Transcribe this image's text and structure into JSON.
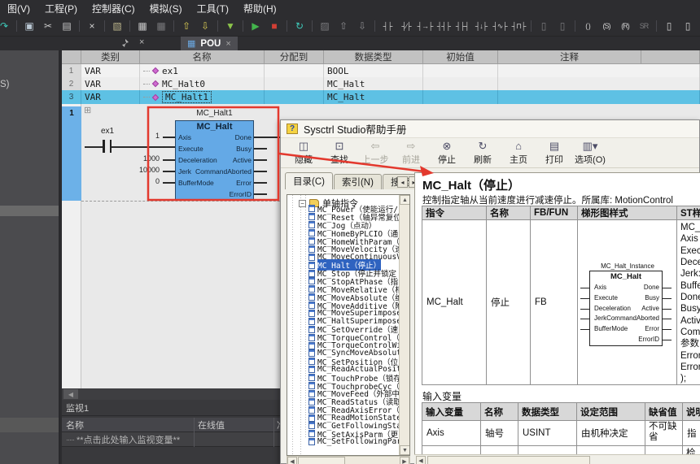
{
  "colors": {
    "accent_blue": "#64a9e6",
    "selection_cyan": "#5ec1e4",
    "annotation_red": "#e3392e",
    "tree_select": "#2f63c0",
    "dark_ui": "#2d2d30",
    "help_bg": "#f1f0ea"
  },
  "menu": {
    "items": [
      {
        "label": "图(V)",
        "name": "view"
      },
      {
        "label": "工程(P)",
        "name": "project"
      },
      {
        "label": "控制器(C)",
        "name": "controller"
      },
      {
        "label": "模拟(S)",
        "name": "simulate"
      },
      {
        "label": "工具(T)",
        "name": "tools"
      },
      {
        "label": "帮助(H)",
        "name": "help"
      }
    ]
  },
  "toolbar": {
    "icons": [
      {
        "glyph": "↷",
        "color": "#3ec9b9",
        "cls": "clip",
        "name": "redo"
      },
      {
        "glyph": "",
        "cls": "sep"
      },
      {
        "glyph": "▣",
        "color": "#b9c6d2",
        "name": "copy"
      },
      {
        "glyph": "✂",
        "color": "#c8c8c8",
        "name": "cut"
      },
      {
        "glyph": "▤",
        "color": "#c8c8c8",
        "name": "paste"
      },
      {
        "glyph": "",
        "cls": "sep"
      },
      {
        "glyph": "×",
        "color": "#d0d0d0",
        "name": "delete"
      },
      {
        "glyph": "",
        "cls": "sep"
      },
      {
        "glyph": "▧",
        "color": "#b9b28a",
        "name": "edit-doc"
      },
      {
        "glyph": "",
        "cls": "sep"
      },
      {
        "glyph": "▦",
        "color": "#c8c8c8",
        "name": "build"
      },
      {
        "glyph": "▦",
        "color": "#79797c",
        "name": "rebuild"
      },
      {
        "glyph": "",
        "cls": "sep"
      },
      {
        "glyph": "⇧",
        "color": "#d9cb54",
        "name": "download-plc"
      },
      {
        "glyph": "⇩",
        "color": "#d9cb54",
        "name": "upload-plc"
      },
      {
        "glyph": "",
        "cls": "sep"
      },
      {
        "glyph": "▼",
        "color": "#8bc34a",
        "name": "filter"
      },
      {
        "glyph": "",
        "cls": "sep"
      },
      {
        "glyph": "▶",
        "color": "#43b44c",
        "name": "run"
      },
      {
        "glyph": "■",
        "color": "#d23f35",
        "name": "stop"
      },
      {
        "glyph": "",
        "cls": "sep"
      },
      {
        "glyph": "↻",
        "color": "#3ec9b9",
        "name": "online-compare"
      },
      {
        "glyph": "",
        "cls": "sep"
      },
      {
        "glyph": "▨",
        "color": "#79797c",
        "name": "snippet"
      },
      {
        "glyph": "⇧",
        "color": "#8a8a8d",
        "name": "move-up"
      },
      {
        "glyph": "⇩",
        "color": "#8a8a8d",
        "name": "move-down"
      },
      {
        "glyph": "",
        "cls": "sep"
      },
      {
        "glyph": "┤├",
        "color": "#cfcfcf",
        "cls": "sm",
        "name": "contact-no"
      },
      {
        "glyph": "┤∕├",
        "color": "#cfcfcf",
        "cls": "sm",
        "name": "contact-nc"
      },
      {
        "glyph": "┤→├",
        "color": "#cfcfcf",
        "cls": "sm",
        "name": "contact-rising"
      },
      {
        "glyph": "┤┤├",
        "color": "#cfcfcf",
        "cls": "sm",
        "name": "contact-parallel-no"
      },
      {
        "glyph": "┤├┤",
        "color": "#cfcfcf",
        "cls": "sm",
        "name": "contact-parallel-nc"
      },
      {
        "glyph": "┤↓├",
        "color": "#cfcfcf",
        "cls": "sm",
        "name": "contact-falling"
      },
      {
        "glyph": "┤∿├",
        "color": "#cfcfcf",
        "cls": "sm",
        "name": "contact-pulse"
      },
      {
        "glyph": "┤⊓├",
        "color": "#cfcfcf",
        "cls": "sm",
        "name": "contact-edge"
      },
      {
        "glyph": "",
        "cls": "sep"
      },
      {
        "glyph": "▯",
        "color": "#79797c",
        "name": "box-dim-1"
      },
      {
        "glyph": "▯",
        "color": "#79797c",
        "name": "box-dim-2"
      },
      {
        "glyph": "",
        "cls": "sep"
      },
      {
        "glyph": "( )",
        "color": "#cfcfcf",
        "cls": "sm",
        "name": "coil"
      },
      {
        "glyph": "(S)",
        "color": "#cfcfcf",
        "cls": "sm",
        "name": "coil-set"
      },
      {
        "glyph": "(R)",
        "color": "#cfcfcf",
        "cls": "sm",
        "name": "coil-reset"
      },
      {
        "glyph": "SR",
        "color": "#79797c",
        "cls": "sm",
        "name": "sr-block"
      },
      {
        "glyph": "",
        "cls": "sep"
      },
      {
        "glyph": "▯",
        "color": "#cfcfcf",
        "name": "fb-insert"
      },
      {
        "glyph": "▯",
        "color": "#cfcfcf",
        "name": "fb-insert-2"
      }
    ]
  },
  "tabs": {
    "pou": "POU",
    "close": "×"
  },
  "sidebar": {
    "clipped_label": "S)"
  },
  "var_table": {
    "headers": [
      "类别",
      "名称",
      "分配到",
      "数据类型",
      "初始值",
      "注释"
    ],
    "rows": [
      {
        "num": "1",
        "cls": "VAR",
        "name": "ex1",
        "assigned": "",
        "type": "BOOL",
        "init": "",
        "comment": ""
      },
      {
        "num": "2",
        "cls": "VAR",
        "name": "MC_Halt0",
        "assigned": "",
        "type": "MC_Halt",
        "init": "",
        "comment": ""
      },
      {
        "num": "3",
        "cls": "VAR",
        "name": "MC_Halt1",
        "assigned": "",
        "type": "MC_Halt",
        "init": "",
        "comment": ""
      }
    ]
  },
  "ladder": {
    "rung_number": "1",
    "contact_label": "ex1",
    "instance_label": "MC_Halt1",
    "block_title": "MC_Halt",
    "inputs": [
      {
        "value": "1",
        "pin": "Axis"
      },
      {
        "value": "",
        "pin": "Execute"
      },
      {
        "value": "1000",
        "pin": "Deceleration"
      },
      {
        "value": "10000",
        "pin": "Jerk"
      },
      {
        "value": "0",
        "pin": "BufferMode"
      }
    ],
    "outputs": [
      "Done",
      "Busy",
      "Active",
      "CommandAborted",
      "Error",
      "ErrorID"
    ]
  },
  "watch": {
    "title": "监视1",
    "col_name": "名称",
    "col_online": "在线值",
    "col_prepared": "准备值",
    "placeholder": "**点击此处输入监视变量**"
  },
  "help": {
    "title": "Sysctrl Studio帮助手册",
    "book_glyph": "?",
    "buttons": [
      {
        "label": "隐藏",
        "glyph": "◫",
        "name": "hide"
      },
      {
        "label": "查找",
        "glyph": "⊡",
        "name": "find"
      },
      {
        "label": "上一步",
        "glyph": "⇦",
        "cls": "disabled",
        "name": "back"
      },
      {
        "label": "前进",
        "glyph": "⇨",
        "cls": "disabled",
        "name": "forward"
      },
      {
        "label": "停止",
        "glyph": "⊗",
        "name": "stop"
      },
      {
        "label": "刷新",
        "glyph": "↻",
        "name": "refresh"
      },
      {
        "label": "主页",
        "glyph": "⌂",
        "name": "home"
      },
      {
        "label": "打印",
        "glyph": "▤",
        "name": "print"
      },
      {
        "label": "选项(O)",
        "glyph": "▥▾",
        "name": "options"
      }
    ],
    "tabs": [
      {
        "label": "目录(C)",
        "cls": "active",
        "name": "contents"
      },
      {
        "label": "索引(N)",
        "name": "index"
      },
      {
        "label": "搜索(S)",
        "name": "search"
      }
    ],
    "tree": {
      "root": "单轴指令",
      "selected_index": 7,
      "items": [
        "MC_Power（使能运行/",
        "MC_Reset（轴异常复位",
        "MC_Jog（点动）",
        "MC_HomeByPLCIO（通",
        "MC_HomeWithParam（参",
        "MC_MoveVelocity（速",
        "MC_MoveContinuousV",
        "MC_Halt（停止）",
        "MC_Stop（停止并锁定",
        "MC_StopAtPhase（指",
        "MC_MoveRelative（相",
        "MC_MoveAbsolute（绝",
        "MC_MoveAdditive（附",
        "MC_MoveSuperimpose",
        "MC_HaltSuperimpose",
        "MC_SetOverride（速",
        "MC_TorqueControl（",
        "MC_TorqueControlWi",
        "MC_SyncMoveAbsolut",
        "MC_SetPosition（位",
        "MC_ReadActualPosit",
        "MC_TouchProbe（锁存",
        "MC_TouchprobeCyc（",
        "MC_MoveFeed（外部中",
        "MC_ReadStatus（读取",
        "MC_ReadAxisError（",
        "MC_ReadMotionState",
        "MC_GetFollowingSta",
        "MC_SetAxisParm（更",
        "MC_SetFollowingPar"
      ]
    },
    "content": {
      "title": "MC_Halt（停止）",
      "desc": "控制指定轴从当前速度进行减速停止。所属库: MotionControl",
      "t1_headers": [
        "指令",
        "名称",
        "FB/FUN",
        "梯形图样式",
        "ST样式"
      ],
      "t1_row": {
        "cmd": "MC_Halt",
        "name": "停止",
        "fbfun": "FB"
      },
      "diagram": {
        "instance": "MC_Halt_Instance",
        "title": "MC_Halt",
        "inputs": [
          "Axis",
          "Execute",
          "Deceleration",
          "Jerk",
          "BufferMode"
        ],
        "outputs": [
          "Done",
          "Busy",
          "Active",
          "CommandAborted",
          "Error",
          "ErrorID"
        ]
      },
      "st_lines": [
        "MC_H",
        "Axis :",
        "Execu",
        "Decel",
        "Jerk:=",
        "Buffer",
        "Done=",
        "Busy=",
        "Active",
        "Comm",
        "参数",
        "Error",
        "ErrorI",
        ");"
      ],
      "section2": "输入变量",
      "t2_headers": [
        "输入变量",
        "名称",
        "数据类型",
        "设定范围",
        "缺省值",
        "说明"
      ],
      "t2_row": [
        "Axis",
        "轴号",
        "USINT",
        "由机种决定",
        "不可缺省",
        "指"
      ],
      "t2_row2_frag": "检"
    }
  }
}
